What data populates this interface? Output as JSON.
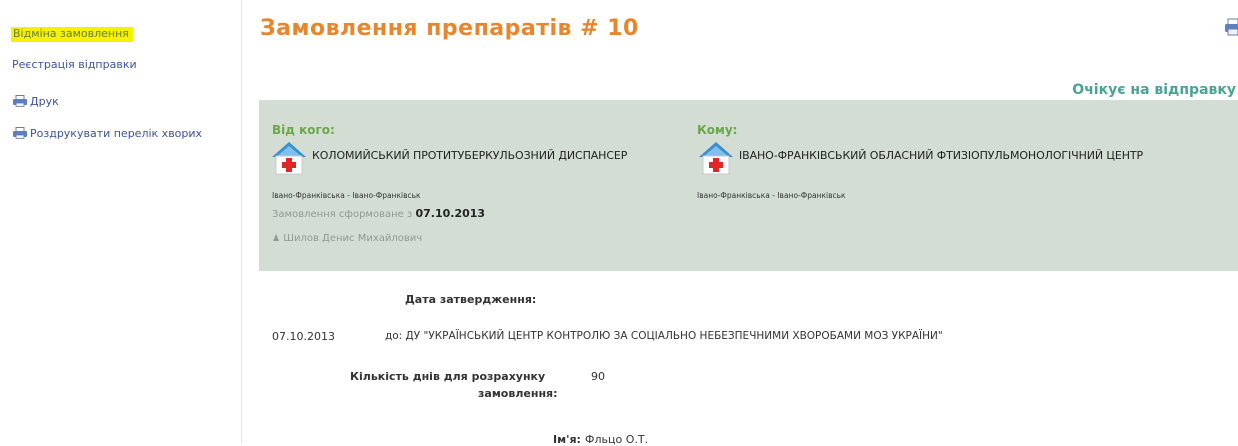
{
  "sidebar": {
    "items": [
      {
        "label": "Відміна замовлення"
      },
      {
        "label": "Реєстрація відправки"
      },
      {
        "label": "Друк"
      },
      {
        "label": "Роздрукувати перелік хворих"
      }
    ]
  },
  "main": {
    "title": "Замовлення препаратів # 10",
    "status": "Очікує на відправку",
    "from": {
      "label": "Від кого:",
      "name": "Коломийський протитуберкульозний диспансер",
      "location": "Івано-Франківська - Івано-Франківськ",
      "order_formed_label": "Замовлення сформоване з",
      "order_date": "07.10.2013",
      "person": "Шилов Денис Михайлович"
    },
    "to": {
      "label": "Кому:",
      "name": "Івано-Франківський обласний фтизіопульмонологічний центр",
      "location": "Івано-Франківська - Івано-Франківськ"
    },
    "approval_label": "Дата затвердження:",
    "approval_date": "07.10.2013",
    "approval_to": "до: ДУ \"УКРАЇНСЬКИЙ ЦЕНТР КОНТРОЛЮ ЗА СОЦІАЛЬНО НЕБЕЗПЕЧНИМИ ХВОРОБАМИ МОЗ УКРАЇНИ\"",
    "days_label_1": "Кількість днів для розрахунку",
    "days_label_2": "замовлення:",
    "days_value": "90",
    "name_label": "Ім'я:",
    "name_value": "Фльцо О.Т."
  },
  "colors": {
    "title": "#e8862d",
    "link": "#3d4f9f",
    "highlight": "#f4f200",
    "panel": "#d4ddd4",
    "status": "#4aa394",
    "green_label": "#6aa64a"
  },
  "icons": {
    "print": "printer-icon",
    "print_list": "print-list-icon",
    "institution": "hospital-house-icon"
  }
}
